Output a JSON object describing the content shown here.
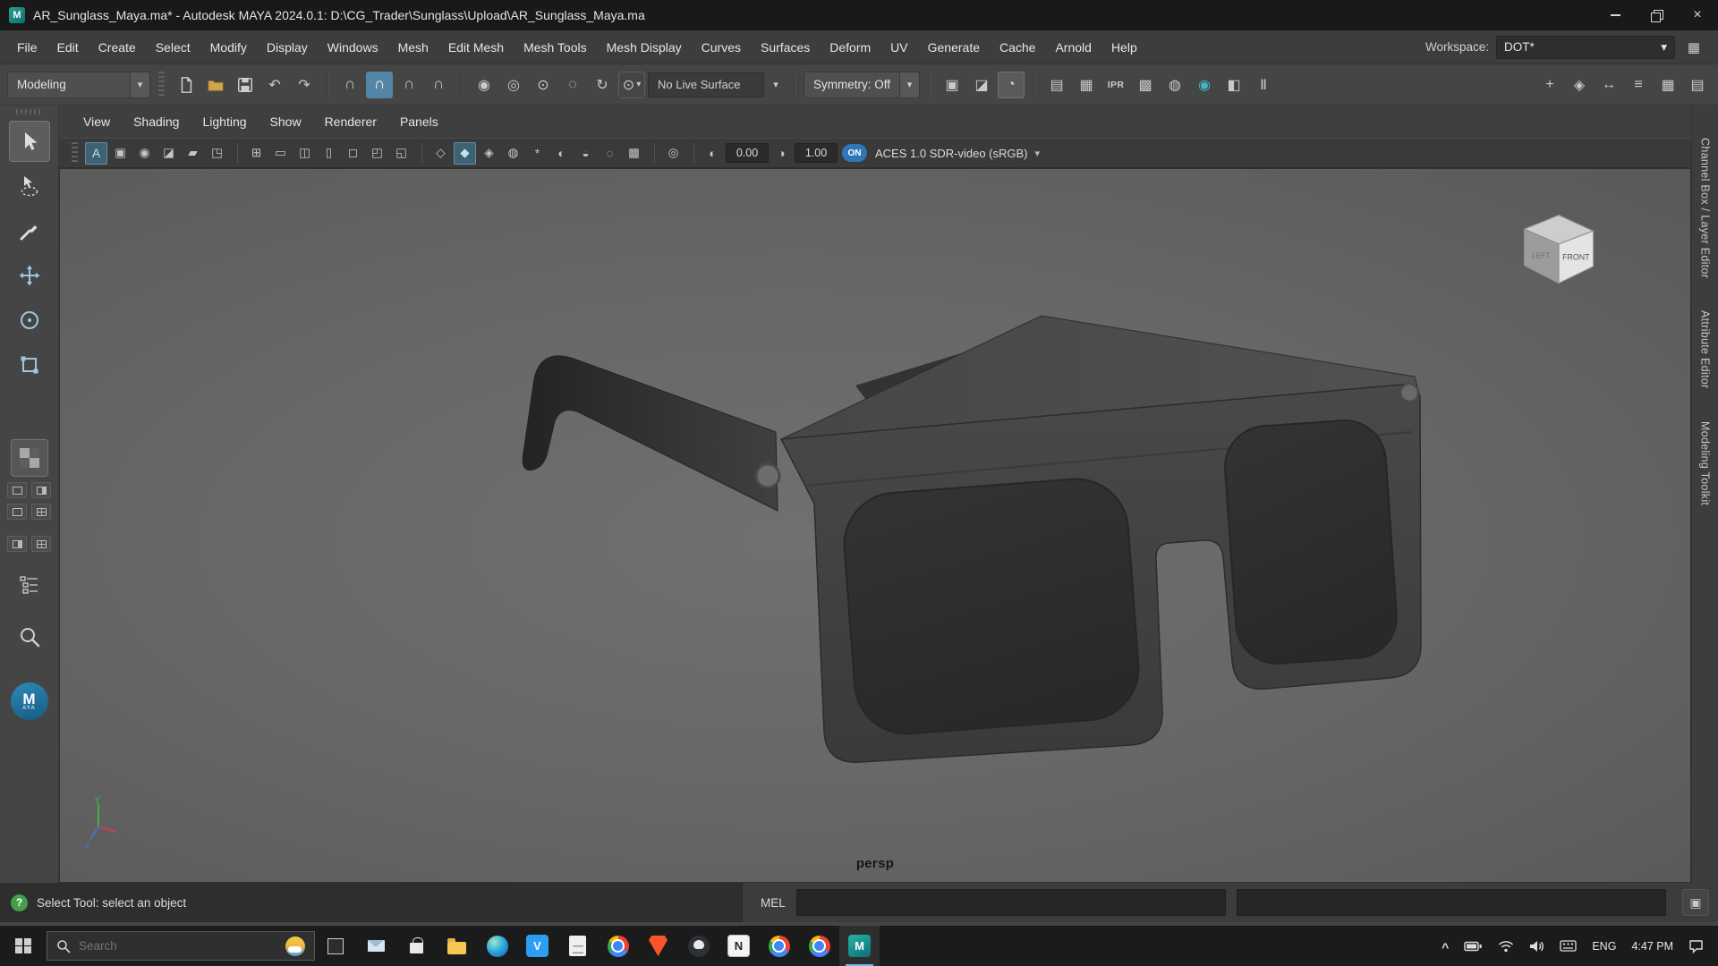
{
  "title_bar": {
    "title": "AR_Sunglass_Maya.ma* - Autodesk MAYA 2024.0.1: D:\\CG_Trader\\Sunglass\\Upload\\AR_Sunglass_Maya.ma",
    "app_monogram": "M"
  },
  "menu_bar": {
    "items": [
      "File",
      "Edit",
      "Create",
      "Select",
      "Modify",
      "Display",
      "Windows",
      "Mesh",
      "Edit Mesh",
      "Mesh Tools",
      "Mesh Display",
      "Curves",
      "Surfaces",
      "Deform",
      "UV",
      "Generate",
      "Cache",
      "Arnold",
      "Help"
    ],
    "workspace_label": "Workspace:",
    "workspace_value": "DOT*"
  },
  "status_line": {
    "mode": "Modeling",
    "live_surface": "No Live Surface",
    "symmetry": "Symmetry: Off",
    "ipr_label": "IPR"
  },
  "panel_menu": {
    "items": [
      "View",
      "Shading",
      "Lighting",
      "Show",
      "Renderer",
      "Panels"
    ]
  },
  "panel_toolbar": {
    "exposure_value": "0.00",
    "gamma_value": "1.00",
    "cm_badge": "ON",
    "view_transform": "ACES 1.0 SDR-video (sRGB)"
  },
  "viewport": {
    "camera_label": "persp",
    "view_cube": {
      "left": "LEFT",
      "front": "FRONT"
    },
    "axes": {
      "y": "y",
      "z": "z"
    }
  },
  "right_tabs": {
    "items": [
      "Channel Box / Layer Editor",
      "Attribute Editor",
      "Modeling Toolkit"
    ]
  },
  "toolbox": {
    "logo_m": "M",
    "logo_aya": "AYA"
  },
  "help_line": {
    "help_glyph": "?",
    "message": "Select Tool: select an object"
  },
  "command_line": {
    "label": "MEL"
  },
  "taskbar": {
    "search_placeholder": "Search",
    "language": "ENG",
    "time": "4:47 PM",
    "app_glyphs": {
      "vscode": "V",
      "notion": "N",
      "maya": "M"
    }
  },
  "glyphs": {
    "dropdown": "▾",
    "undo": "↶",
    "redo": "↷",
    "snap": "∩",
    "inputs": "◉",
    "outputs": "◎",
    "history": "⊙",
    "rivet": "◌",
    "refresh": "↻",
    "select_box": "⊙",
    "toggle1": "▣",
    "toggle2": "◪",
    "toggle3": "◔",
    "render_view": "▤",
    "render_frame": "▦",
    "render_sequence": "▩",
    "toon": "◍",
    "hypershade": "◉",
    "render_settings": "◧",
    "pause": "Ⅱ",
    "align": "+",
    "pivot": "◈",
    "transform": "↔",
    "layers": "≡",
    "grid": "▦",
    "outliner": "▤",
    "cam_attr": "A",
    "image_plane": "▣",
    "camera": "◉",
    "bookmark": "◪",
    "film": "▰",
    "pan_zoom": "◳",
    "vp_grid": "⊞",
    "film_gate": "▭",
    "res_gate": "◫",
    "gate_mask": "▯",
    "field_chart": "◻",
    "safe_action": "◰",
    "safe_title": "◱",
    "wireframe": "◇",
    "shaded": "◆",
    "textured": "◈",
    "default_mat": "◍",
    "lights": "*",
    "shadows": "◐",
    "ao": "◒",
    "motion_blur": "◌",
    "msaa": "▩",
    "isolate": "◎",
    "exposure": "◐",
    "gamma": "◑",
    "close": "×",
    "script_editor": "▣",
    "ws_grid": "▦",
    "chevron_up": "^"
  },
  "colors": {
    "accent_blue": "#5285a6",
    "active_teal": "#3f6273",
    "viewport_gray": "#6a6a6a",
    "taskbar_accent": "#76b9ed"
  }
}
